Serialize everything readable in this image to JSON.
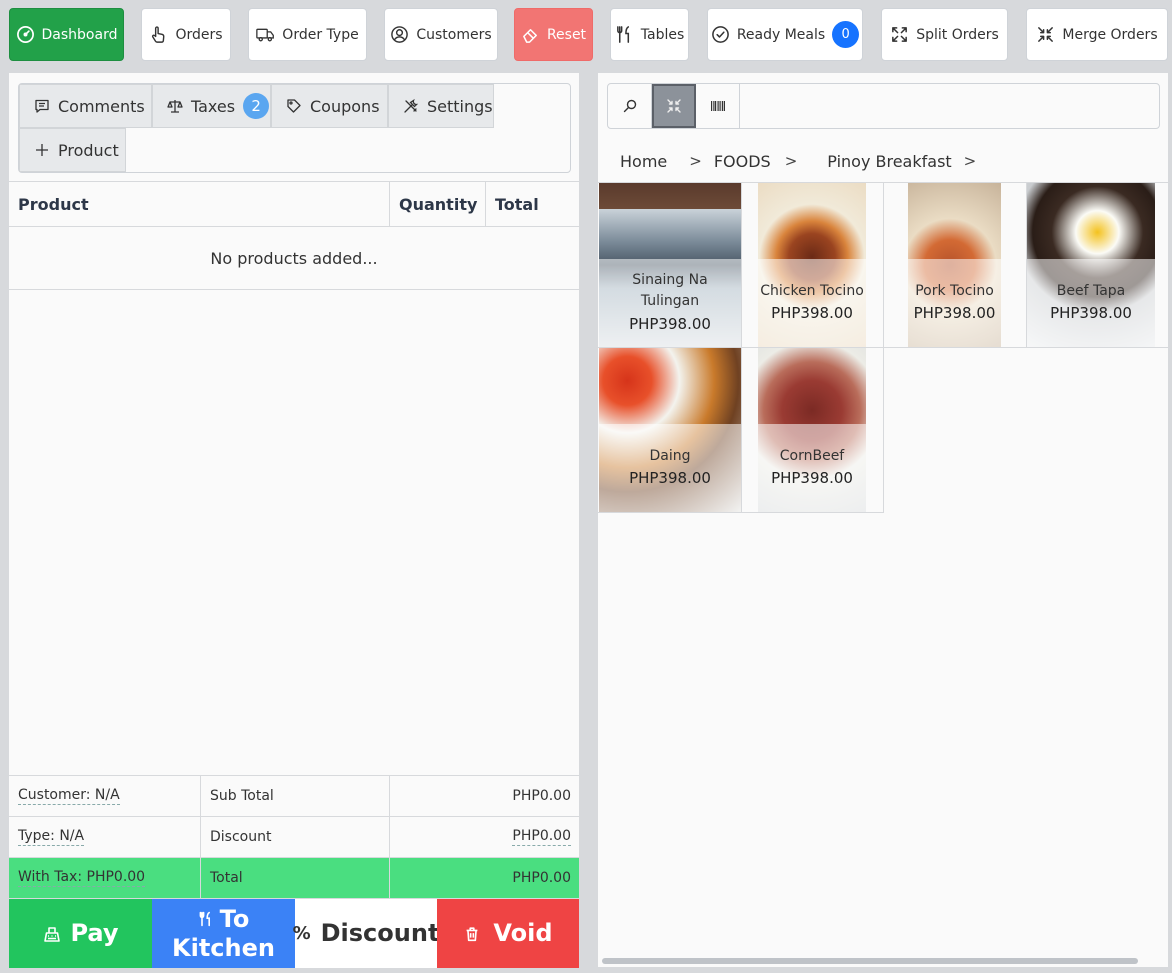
{
  "topbar": {
    "dashboard": "Dashboard",
    "orders": "Orders",
    "order_type": "Order Type",
    "customers": "Customers",
    "reset": "Reset",
    "tables": "Tables",
    "ready_meals": "Ready Meals",
    "ready_meals_count": "0",
    "split_orders": "Split Orders",
    "merge_orders": "Merge Orders"
  },
  "order_tabs": {
    "comments": "Comments",
    "taxes": "Taxes",
    "taxes_count": "2",
    "coupons": "Coupons",
    "settings": "Settings",
    "product": "Product"
  },
  "cart_table": {
    "headers": [
      "Product",
      "Quantity",
      "Total"
    ],
    "empty_message": "No products added..."
  },
  "summary": {
    "customer": "Customer: N/A",
    "type": "Type: N/A",
    "with_tax": "With Tax: PHP0.00",
    "subtotal_label": "Sub Total",
    "subtotal_value": "PHP0.00",
    "discount_label": "Discount",
    "discount_value": "PHP0.00",
    "total_label": "Total",
    "total_value": "PHP0.00"
  },
  "actions": {
    "pay": "Pay",
    "to_kitchen_line1": "To",
    "to_kitchen_line2": "Kitchen",
    "discount": "Discount",
    "void": "Void"
  },
  "breadcrumb": [
    "Home",
    "FOODS",
    "Pinoy Breakfast"
  ],
  "products": [
    {
      "name": "Sinaing Na Tulingan",
      "price": "PHP398.00"
    },
    {
      "name": "Chicken Tocino",
      "price": "PHP398.00"
    },
    {
      "name": "Pork Tocino",
      "price": "PHP398.00"
    },
    {
      "name": "Beef Tapa",
      "price": "PHP398.00"
    },
    {
      "name": "Daing",
      "price": "PHP398.00"
    },
    {
      "name": "CornBeef",
      "price": "PHP398.00"
    }
  ],
  "colors": {
    "dashboard_green": "#22a149",
    "reset_red": "#f27573",
    "badge_blue": "#1673ff",
    "pay_green": "#22c55e",
    "kitchen_blue": "#3b82f6",
    "void_red": "#ef4444",
    "total_row_green": "#4ade80"
  }
}
